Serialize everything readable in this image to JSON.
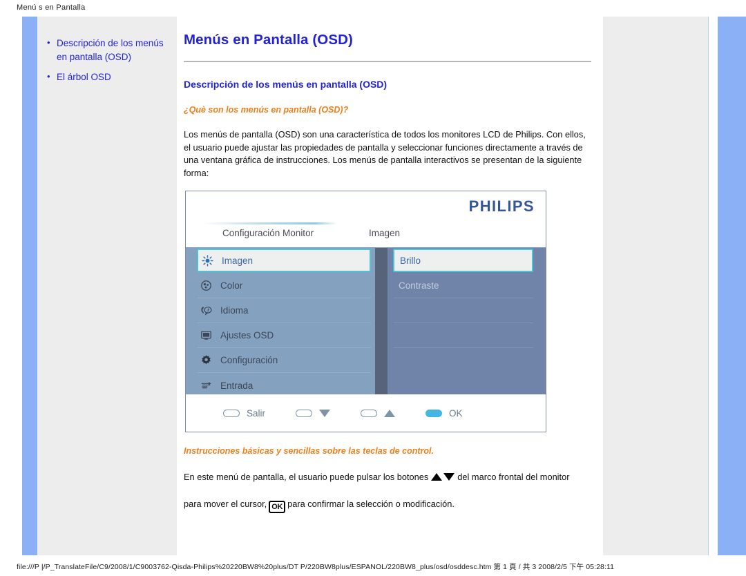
{
  "print_header": "Menú s en Pantalla",
  "print_footer": "file:///P |/P_TranslateFile/C9/2008/1/C9003762-Qisda-Philips%20220BW8%20plus/DT P/220BW8plus/ESPANOL/220BW8_plus/osd/osddesc.htm 第 1 頁 / 共 3 2008/2/5 下午 05:28:11",
  "sidebar": {
    "items": [
      {
        "label": "Descripción de los menús en pantalla (OSD)"
      },
      {
        "label": "El árbol OSD"
      }
    ]
  },
  "main": {
    "page_title": "Menús en Pantalla (OSD)",
    "section_title": "Descripción de los menús en pantalla (OSD)",
    "sub_title": "¿Què son los menús en pantalla (OSD)?",
    "paragraph": "Los menús de pantalla (OSD) son una característica de todos los monitores LCD de Philips. Con ellos, el usuario puede ajustar las propiedades de pantalla y seleccionar funciones directamente a través de una ventana gráfica de instrucciones. Los menús de pantalla interactivos se presentan de la siguiente forma:",
    "instructions_title": "Instrucciones básicas y sencillas sobre las teclas de control.",
    "instructions_part1": "En este menú de pantalla, el usuario puede pulsar los botones",
    "instructions_part2": "del marco frontal del monitor",
    "instructions_part3": "para mover el cursor,",
    "instructions_ok_key": "OK",
    "instructions_part4": "para confirmar la selección o modificación."
  },
  "osd": {
    "brand": "PHILIPS",
    "tab_left": "Configuración Monitor",
    "tab_right": "Imagen",
    "left_menu": [
      {
        "label": "Imagen",
        "icon": "brightness-icon",
        "selected": true
      },
      {
        "label": "Color",
        "icon": "color-palette-icon",
        "selected": false
      },
      {
        "label": "Idioma",
        "icon": "language-icon",
        "selected": false
      },
      {
        "label": "Ajustes OSD",
        "icon": "osd-monitor-icon",
        "selected": false
      },
      {
        "label": "Configuración",
        "icon": "gear-icon",
        "selected": false
      },
      {
        "label": "Entrada",
        "icon": "input-arrows-icon",
        "selected": false
      }
    ],
    "right_menu": [
      {
        "label": "Brillo",
        "selected": true
      },
      {
        "label": "Contraste",
        "selected": false
      },
      {
        "label": "",
        "selected": false
      },
      {
        "label": "",
        "selected": false
      },
      {
        "label": "",
        "selected": false
      }
    ],
    "footer_buttons": [
      {
        "label": "Salir",
        "glyph": "none",
        "active": false
      },
      {
        "label": "",
        "glyph": "down",
        "active": false
      },
      {
        "label": "",
        "glyph": "up",
        "active": false
      },
      {
        "label": "OK",
        "glyph": "none",
        "active": true
      }
    ]
  },
  "colors": {
    "link_blue": "#2222dd",
    "accent_orange": "#f07f1a",
    "philips_blue": "#33559c",
    "osd_panel_left": "#84a2bf",
    "osd_panel_right": "#6f84a8",
    "osd_highlight": "#4fc2d8",
    "rail_blue": "#8cb0f5",
    "page_gray": "#ededed"
  }
}
